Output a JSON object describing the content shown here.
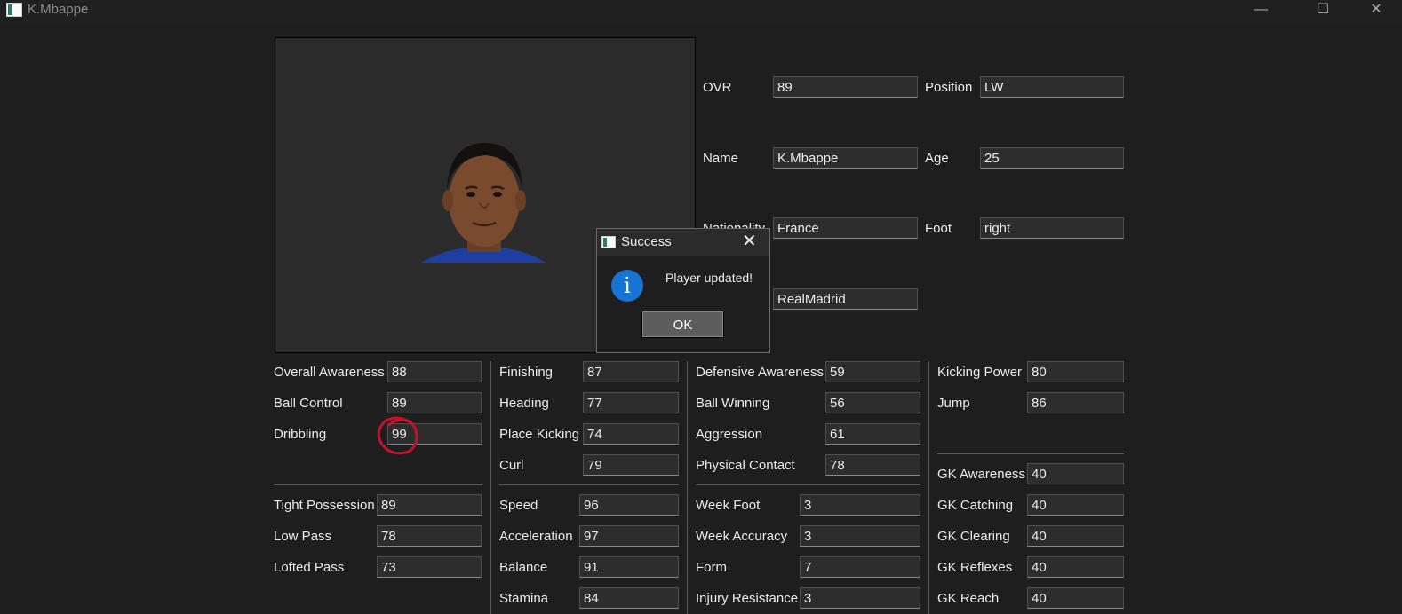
{
  "window": {
    "title": "K.Mbappe",
    "minimize": "—",
    "maximize": "☐",
    "close": "✕"
  },
  "player": {
    "ovr_label": "OVR",
    "ovr": "89",
    "position_label": "Position",
    "position": "LW",
    "name_label": "Name",
    "name": "K.Mbappe",
    "age_label": "Age",
    "age": "25",
    "nationality_label": "Nationality",
    "nationality": "France",
    "foot_label": "Foot",
    "foot": "right",
    "club": "RealMadrid"
  },
  "stats": {
    "col1": [
      {
        "label": "Overall Awareness",
        "value": "88"
      },
      {
        "label": "Ball Control",
        "value": "89"
      },
      {
        "label": "Dribbling",
        "value": "99"
      },
      {
        "label": "Tight Possession",
        "value": "89"
      },
      {
        "label": "Low Pass",
        "value": "78"
      },
      {
        "label": "Lofted Pass",
        "value": "73"
      }
    ],
    "col2": [
      {
        "label": "Finishing",
        "value": "87"
      },
      {
        "label": "Heading",
        "value": "77"
      },
      {
        "label": "Place Kicking",
        "value": "74"
      },
      {
        "label": "Curl",
        "value": "79"
      },
      {
        "label": "Speed",
        "value": "96"
      },
      {
        "label": "Acceleration",
        "value": "97"
      },
      {
        "label": "Balance",
        "value": "91"
      },
      {
        "label": "Stamina",
        "value": "84"
      }
    ],
    "col3": [
      {
        "label": "Defensive Awareness",
        "value": "59"
      },
      {
        "label": "Ball Winning",
        "value": "56"
      },
      {
        "label": "Aggression",
        "value": "61"
      },
      {
        "label": "Physical Contact",
        "value": "78"
      },
      {
        "label": "Week Foot",
        "value": "3"
      },
      {
        "label": "Week Accuracy",
        "value": "3"
      },
      {
        "label": "Form",
        "value": "7"
      },
      {
        "label": "Injury Resistance",
        "value": "3"
      }
    ],
    "col4": [
      {
        "label": "Kicking Power",
        "value": "80"
      },
      {
        "label": "Jump",
        "value": "86"
      },
      {
        "label": "GK Awareness",
        "value": "40"
      },
      {
        "label": "GK Catching",
        "value": "40"
      },
      {
        "label": "GK Clearing",
        "value": "40"
      },
      {
        "label": "GK Reflexes",
        "value": "40"
      },
      {
        "label": "GK Reach",
        "value": "40"
      }
    ]
  },
  "dialog": {
    "title": "Success",
    "message": "Player updated!",
    "ok_label": "OK",
    "close_glyph": "✕",
    "info_glyph": "i"
  },
  "annotation_color": "#c8102e"
}
